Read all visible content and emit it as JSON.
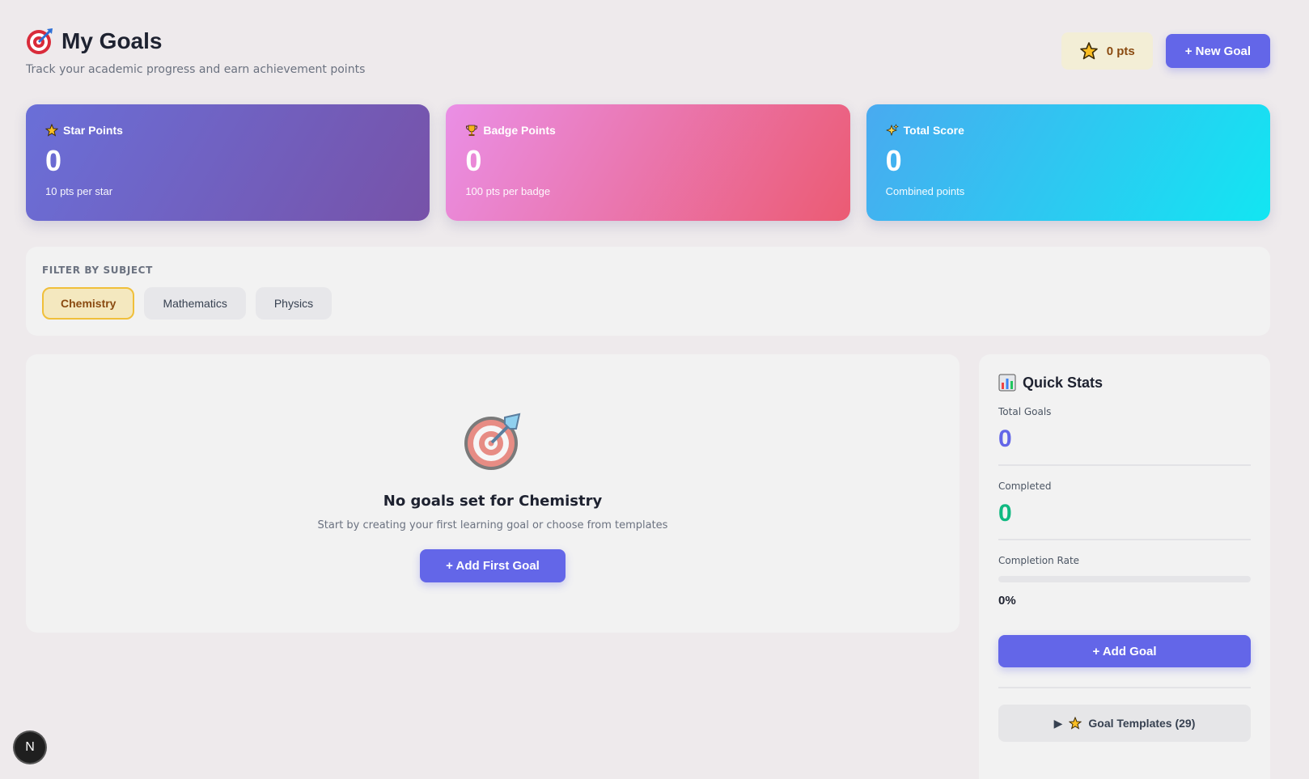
{
  "header": {
    "title": "My Goals",
    "subtitle": "Track your academic progress and earn achievement points",
    "points_label": "0 pts",
    "new_goal_label": "+ New Goal",
    "title_icon": "target-icon"
  },
  "cards": [
    {
      "label": "Star Points",
      "value": "0",
      "sub": "10 pts per star",
      "icon": "star-icon"
    },
    {
      "label": "Badge Points",
      "value": "0",
      "sub": "100 pts per badge",
      "icon": "trophy-icon"
    },
    {
      "label": "Total Score",
      "value": "0",
      "sub": "Combined points",
      "icon": "sparkles-icon"
    }
  ],
  "filter": {
    "label": "FILTER BY SUBJECT",
    "subjects": [
      "Chemistry",
      "Mathematics",
      "Physics"
    ],
    "active": "Chemistry"
  },
  "empty": {
    "title": "No goals set for Chemistry",
    "subtitle": "Start by creating your first learning goal or choose from templates",
    "button": "+ Add First Goal"
  },
  "stats": {
    "title": "Quick Stats",
    "total_label": "Total Goals",
    "total_value": "0",
    "completed_label": "Completed",
    "completed_value": "0",
    "rate_label": "Completion Rate",
    "rate_value": "0%",
    "rate_fraction": 0,
    "add_goal": "+ Add Goal",
    "templates": "Goal Templates (29)"
  },
  "dev_badge": "N",
  "colors": {
    "accent": "#6366e8",
    "green": "#10b981",
    "chip_active": "#f4e8bf"
  }
}
